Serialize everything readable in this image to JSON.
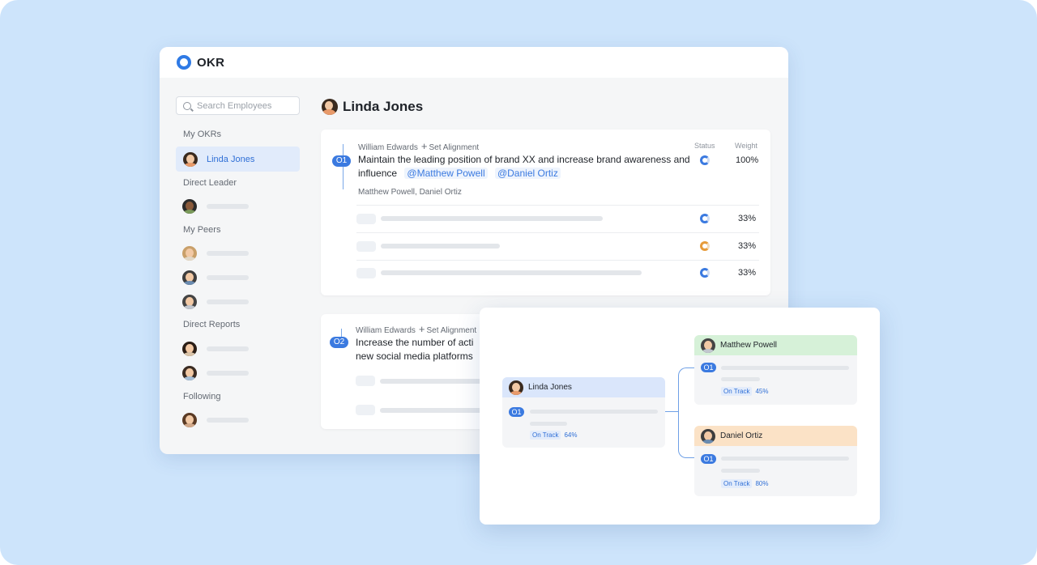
{
  "app": {
    "title": "OKR"
  },
  "sidebar": {
    "search_placeholder": "Search Employees",
    "sections": {
      "my_okrs": "My OKRs",
      "direct_leader": "Direct Leader",
      "my_peers": "My Peers",
      "direct_reports": "Direct Reports",
      "following": "Following"
    },
    "selected_user": "Linda Jones"
  },
  "main": {
    "user_name": "Linda Jones",
    "objectives": [
      {
        "badge": "O1",
        "aligned_to": "William Edwards",
        "set_alignment": "Set Alignment",
        "text": "Maintain the leading position of brand XX and increase brand awareness and influence",
        "mentions": [
          "@Matthew Powell",
          "@Daniel Ortiz"
        ],
        "aligned_by": "Matthew Powell, Daniel Ortiz",
        "status_header": "Status",
        "weight_header": "Weight",
        "weight": "100%",
        "key_results": [
          {
            "weight": "33%",
            "status_color": "#3b7ae0"
          },
          {
            "weight": "33%",
            "status_color": "#e69b3a"
          },
          {
            "weight": "33%",
            "status_color": "#3b7ae0"
          }
        ]
      },
      {
        "badge": "O2",
        "aligned_to": "William Edwards",
        "set_alignment": "Set Alignment",
        "text": "Increase the number of acti",
        "text_line2": "new social media platforms"
      }
    ]
  },
  "alignment_panel": {
    "root": {
      "name": "Linda Jones",
      "badge": "O1",
      "status": "On Track",
      "progress": "64%"
    },
    "children": [
      {
        "name": "Matthew Powell",
        "badge": "O1",
        "status": "On Track",
        "progress": "45%"
      },
      {
        "name": "Daniel Ortiz",
        "badge": "O1",
        "status": "On Track",
        "progress": "80%"
      }
    ]
  },
  "colors": {
    "accent": "#3b7ae0",
    "background": "#cde4fb",
    "warning": "#e69b3a"
  }
}
